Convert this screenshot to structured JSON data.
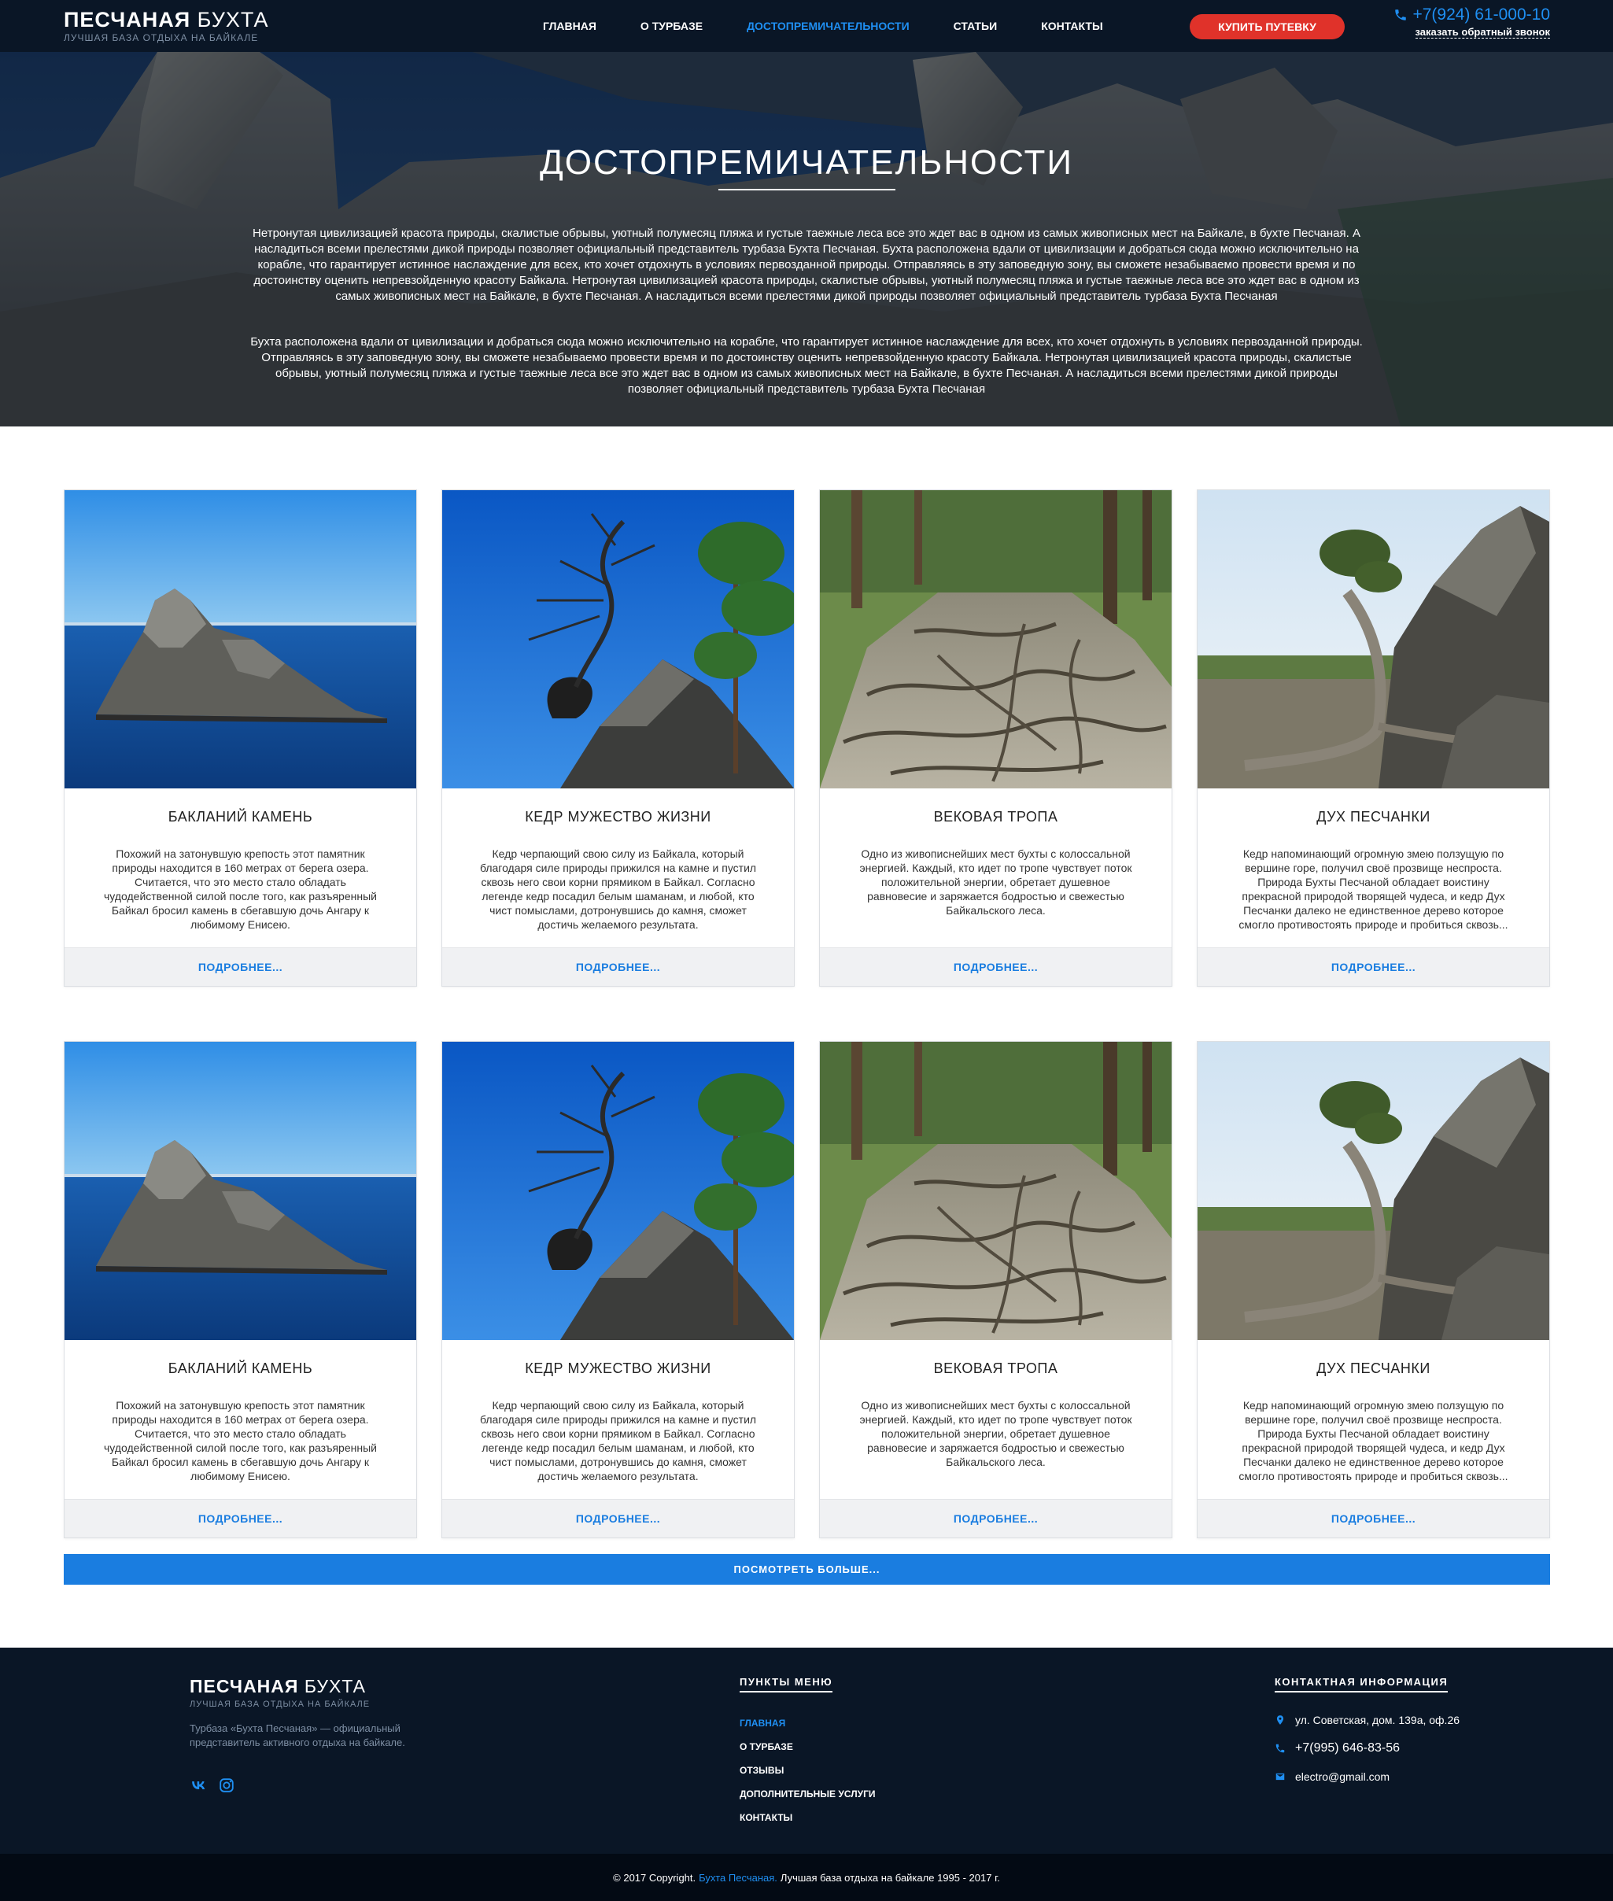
{
  "header": {
    "logo_bold": "ПЕСЧАНАЯ",
    "logo_light": "БУХТА",
    "logo_sub": "ЛУЧШАЯ БАЗА ОТДЫХА НА БАЙКАЛЕ",
    "nav": [
      {
        "label": "ГЛАВНАЯ",
        "active": false
      },
      {
        "label": "О ТУРБАЗЕ",
        "active": false
      },
      {
        "label": "ДОСТОПРЕМИЧАТЕЛЬНОСТИ",
        "active": true
      },
      {
        "label": "СТАТЬИ",
        "active": false
      },
      {
        "label": "КОНТАКТЫ",
        "active": false
      }
    ],
    "buy_button": "КУПИТЬ ПУТЕВКУ",
    "phone": "+7(924) 61-000-10",
    "callback": "заказать обратный звонок"
  },
  "hero": {
    "title": "ДОСТОПРЕМИЧАТЕЛЬНОСТИ",
    "paragraph1": "Нетронутая цивилизацией красота природы, скалистые обрывы, уютный полумесяц пляжа и густые таежные леса все это ждет вас в одном из самых живописных мест на Байкале, в бухте Песчаная. А насладиться всеми прелестями дикой природы позволяет официальный представитель турбаза Бухта Песчаная. Бухта расположена вдали от цивилизации и добраться сюда можно исключительно на корабле, что гарантирует истинное наслаждение для всех, кто хочет отдохнуть в условиях первозданной природы. Отправляясь в эту заповедную зону, вы сможете незабываемо провести время и по достоинству оценить непревзойденную красоту Байкала. Нетронутая цивилизацией красота природы, скалистые обрывы, уютный полумесяц пляжа и густые таежные леса все это ждет вас в одном из самых живописных мест на Байкале, в бухте Песчаная. А насладиться всеми прелестями дикой природы позволяет официальный представитель турбаза Бухта Песчаная",
    "paragraph2": "Бухта расположена вдали от цивилизации и добраться сюда можно исключительно на корабле, что гарантирует истинное наслаждение для всех, кто хочет отдохнуть в условиях первозданной природы. Отправляясь в эту заповедную зону, вы сможете незабываемо провести время и по достоинству оценить непревзойденную красоту Байкала. Нетронутая цивилизацией красота природы, скалистые обрывы, уютный полумесяц пляжа и густые таежные леса все это ждет вас в одном из самых живописных мест на Байкале, в бухте Песчаная. А насладиться всеми прелестями дикой природы позволяет официальный представитель турбаза Бухта Песчаная"
  },
  "cards": [
    {
      "title": "БАКЛАНИЙ КАМЕНЬ",
      "text": "Похожий на затонувшую крепость этот памятник природы находится в 160 метрах от берега озера. Считается, что это место стало обладать чудодейственной силой после того, как разъяренный Байкал бросил камень в сбегавшую дочь Ангару к любимому Енисею.",
      "button": "ПОДРОБНЕЕ..."
    },
    {
      "title": "КЕДР МУЖЕСТВО ЖИЗНИ",
      "text": "Кедр черпающий свою силу из Байкала, который благодаря силе природы прижился на камне и пустил сквозь него свои корни прямиком в Байкал. Согласно легенде кедр посадил белым шаманам, и любой, кто чист помыслами, дотронувшись до камня, сможет достичь желаемого результата.",
      "button": "ПОДРОБНЕЕ..."
    },
    {
      "title": "ВЕКОВАЯ ТРОПА",
      "text": "Одно из живописнейших мест бухты с колоссальной энергией. Каждый, кто идет по тропе чувствует поток положительной энергии, обретает душевное равновесие и заряжается бодростью и свежестью Байкальского леса.",
      "button": "ПОДРОБНЕЕ..."
    },
    {
      "title": "ДУХ ПЕСЧАНКИ",
      "text": "Кедр напоминающий огромную змею ползущую по вершине горе, получил своё прозвище неспроста. Природа Бухты Песчаной обладает воистину прекрасной природой творящей чудеса, и кедр Дух Песчанки далеко не единственное дерево которое смогло противостоять природе и пробиться сквозь...",
      "button": "ПОДРОБНЕЕ..."
    },
    {
      "title": "БАКЛАНИЙ КАМЕНЬ",
      "text": "Похожий на затонувшую крепость этот памятник природы находится в 160 метрах от берега озера. Считается, что это место стало обладать чудодейственной силой после того, как разъяренный Байкал бросил камень в сбегавшую дочь Ангару к любимому Енисею.",
      "button": "ПОДРОБНЕЕ..."
    },
    {
      "title": "КЕДР МУЖЕСТВО ЖИЗНИ",
      "text": "Кедр черпающий свою силу из Байкала, который благодаря силе природы прижился на камне и пустил сквозь него свои корни прямиком в Байкал. Согласно легенде кедр посадил белым шаманам, и любой, кто чист помыслами, дотронувшись до камня, сможет достичь желаемого результата.",
      "button": "ПОДРОБНЕЕ..."
    },
    {
      "title": "ВЕКОВАЯ ТРОПА",
      "text": "Одно из живописнейших мест бухты с колоссальной энергией. Каждый, кто идет по тропе чувствует поток положительной энергии, обретает душевное равновесие и заряжается бодростью и свежестью Байкальского леса.",
      "button": "ПОДРОБНЕЕ..."
    },
    {
      "title": "ДУХ ПЕСЧАНКИ",
      "text": "Кедр напоминающий огромную змею ползущую по вершине горе, получил своё прозвище неспроста. Природа Бухты Песчаной обладает воистину прекрасной природой творящей чудеса, и кедр Дух Песчанки далеко не единственное дерево которое смогло противостоять природе и пробиться сквозь...",
      "button": "ПОДРОБНЕЕ..."
    }
  ],
  "more_button": "ПОСМОТРЕТЬ БОЛЬШЕ...",
  "footer": {
    "logo_bold": "ПЕСЧАНАЯ",
    "logo_light": "БУХТА",
    "logo_sub": "ЛУЧШАЯ БАЗА ОТДЫХА НА БАЙКАЛЕ",
    "description": "Турбаза «Бухта Песчаная» — официальный представитель активного отдыха на байкале.",
    "social": [
      "vk-icon",
      "instagram-icon"
    ],
    "menu_heading": "ПУНКТЫ МЕНЮ",
    "menu": [
      {
        "label": "ГЛАВНАЯ",
        "active": true
      },
      {
        "label": "О ТУРБАЗЕ",
        "active": false
      },
      {
        "label": "ОТЗЫВЫ",
        "active": false
      },
      {
        "label": "ДОПОЛНИТЕЛЬНЫЕ УСЛУГИ",
        "active": false
      },
      {
        "label": "КОНТАКТЫ",
        "active": false
      }
    ],
    "contacts_heading": "КОНТАКТНАЯ ИНФОРМАЦИЯ",
    "address": "ул. Советская, дом. 139а, оф.26",
    "phone": "+7(995) 646-83-56",
    "email": "electro@gmail.com"
  },
  "copyright": {
    "prefix": "© 2017 Copyright.",
    "brand": "Бухта Песчаная.",
    "suffix": "Лучшая база отдыха на байкале 1995 - 2017 г."
  },
  "colors": {
    "accent": "#1f8ff2",
    "buy_button": "#e0322a",
    "nav_bg": "#0a1626",
    "more_button": "#1a7de0"
  }
}
